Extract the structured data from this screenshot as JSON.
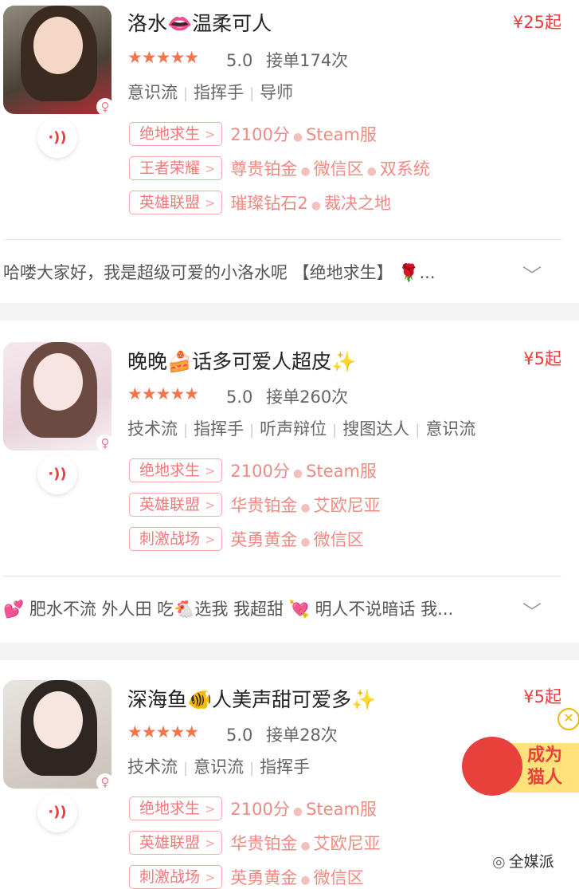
{
  "cards": [
    {
      "title": "洛水👄温柔可人",
      "price": "¥25起",
      "stars": "★★★★★",
      "rating": "5.0",
      "orders": "接单174次",
      "tags": [
        "意识流",
        "指挥手",
        "导师"
      ],
      "games": [
        {
          "name": "绝地求生",
          "details": [
            "2100分",
            "Steam服"
          ]
        },
        {
          "name": "王者荣耀",
          "details": [
            "尊贵铂金",
            "微信区",
            "双系统"
          ]
        },
        {
          "name": "英雄联盟",
          "details": [
            "璀璨钻石2",
            "裁决之地"
          ]
        }
      ],
      "bio": "哈喽大家好，我是超级可爱的小洛水呢 【绝地求生】 🌹..."
    },
    {
      "title": "晚晚🍰话多可爱人超皮✨",
      "price": "¥5起",
      "stars": "★★★★★",
      "rating": "5.0",
      "orders": "接单260次",
      "tags": [
        "技术流",
        "指挥手",
        "听声辩位",
        "搜图达人",
        "意识流"
      ],
      "games": [
        {
          "name": "绝地求生",
          "details": [
            "2100分",
            "Steam服"
          ]
        },
        {
          "name": "英雄联盟",
          "details": [
            "华贵铂金",
            "艾欧尼亚"
          ]
        },
        {
          "name": "刺激战场",
          "details": [
            "英勇黄金",
            "微信区"
          ]
        }
      ],
      "bio": "💕 肥水不流 外人田 吃🐔选我 我超甜 💘 明人不说暗话 我..."
    },
    {
      "title": "深海鱼🐠人美声甜可爱多✨",
      "price": "¥5起",
      "stars": "★★★★★",
      "rating": "5.0",
      "orders": "接单28次",
      "tags": [
        "技术流",
        "意识流",
        "指挥手"
      ],
      "games": [
        {
          "name": "绝地求生",
          "details": [
            "2100分",
            "Steam服"
          ]
        },
        {
          "name": "英雄联盟",
          "details": [
            "华贵铂金",
            "艾欧尼亚"
          ]
        },
        {
          "name": "刺激战场",
          "details": [
            "英勇黄金",
            "微信区"
          ]
        }
      ]
    }
  ],
  "icons": {
    "gender": "♀",
    "voice": "·))",
    "chevron": "﹀",
    "close": "✕"
  },
  "promo": {
    "line1": "成为",
    "line2": "猫人"
  },
  "watermark": "全媒派",
  "colors": {
    "accent": "#ee3b3b",
    "star": "#f5744b",
    "chip_border": "#f4a9a6"
  }
}
